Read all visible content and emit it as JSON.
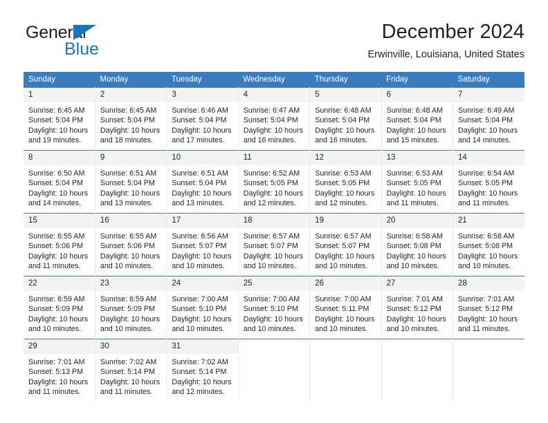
{
  "brand": {
    "name_part1": "General",
    "name_part2": "Blue",
    "triangle_icon": "triangle-icon",
    "accent_color": "#1b75bb"
  },
  "header": {
    "title": "December 2024",
    "subtitle": "Erwinville, Louisiana, United States"
  },
  "calendar": {
    "header_bg": "#3a7cc0",
    "daynum_bg": "#f3f3f3",
    "weekdays": [
      "Sunday",
      "Monday",
      "Tuesday",
      "Wednesday",
      "Thursday",
      "Friday",
      "Saturday"
    ],
    "weeks": [
      [
        {
          "day": "1",
          "sunrise": "Sunrise: 6:45 AM",
          "sunset": "Sunset: 5:04 PM",
          "daylight1": "Daylight: 10 hours",
          "daylight2": "and 19 minutes."
        },
        {
          "day": "2",
          "sunrise": "Sunrise: 6:45 AM",
          "sunset": "Sunset: 5:04 PM",
          "daylight1": "Daylight: 10 hours",
          "daylight2": "and 18 minutes."
        },
        {
          "day": "3",
          "sunrise": "Sunrise: 6:46 AM",
          "sunset": "Sunset: 5:04 PM",
          "daylight1": "Daylight: 10 hours",
          "daylight2": "and 17 minutes."
        },
        {
          "day": "4",
          "sunrise": "Sunrise: 6:47 AM",
          "sunset": "Sunset: 5:04 PM",
          "daylight1": "Daylight: 10 hours",
          "daylight2": "and 16 minutes."
        },
        {
          "day": "5",
          "sunrise": "Sunrise: 6:48 AM",
          "sunset": "Sunset: 5:04 PM",
          "daylight1": "Daylight: 10 hours",
          "daylight2": "and 16 minutes."
        },
        {
          "day": "6",
          "sunrise": "Sunrise: 6:48 AM",
          "sunset": "Sunset: 5:04 PM",
          "daylight1": "Daylight: 10 hours",
          "daylight2": "and 15 minutes."
        },
        {
          "day": "7",
          "sunrise": "Sunrise: 6:49 AM",
          "sunset": "Sunset: 5:04 PM",
          "daylight1": "Daylight: 10 hours",
          "daylight2": "and 14 minutes."
        }
      ],
      [
        {
          "day": "8",
          "sunrise": "Sunrise: 6:50 AM",
          "sunset": "Sunset: 5:04 PM",
          "daylight1": "Daylight: 10 hours",
          "daylight2": "and 14 minutes."
        },
        {
          "day": "9",
          "sunrise": "Sunrise: 6:51 AM",
          "sunset": "Sunset: 5:04 PM",
          "daylight1": "Daylight: 10 hours",
          "daylight2": "and 13 minutes."
        },
        {
          "day": "10",
          "sunrise": "Sunrise: 6:51 AM",
          "sunset": "Sunset: 5:04 PM",
          "daylight1": "Daylight: 10 hours",
          "daylight2": "and 13 minutes."
        },
        {
          "day": "11",
          "sunrise": "Sunrise: 6:52 AM",
          "sunset": "Sunset: 5:05 PM",
          "daylight1": "Daylight: 10 hours",
          "daylight2": "and 12 minutes."
        },
        {
          "day": "12",
          "sunrise": "Sunrise: 6:53 AM",
          "sunset": "Sunset: 5:05 PM",
          "daylight1": "Daylight: 10 hours",
          "daylight2": "and 12 minutes."
        },
        {
          "day": "13",
          "sunrise": "Sunrise: 6:53 AM",
          "sunset": "Sunset: 5:05 PM",
          "daylight1": "Daylight: 10 hours",
          "daylight2": "and 11 minutes."
        },
        {
          "day": "14",
          "sunrise": "Sunrise: 6:54 AM",
          "sunset": "Sunset: 5:05 PM",
          "daylight1": "Daylight: 10 hours",
          "daylight2": "and 11 minutes."
        }
      ],
      [
        {
          "day": "15",
          "sunrise": "Sunrise: 6:55 AM",
          "sunset": "Sunset: 5:06 PM",
          "daylight1": "Daylight: 10 hours",
          "daylight2": "and 11 minutes."
        },
        {
          "day": "16",
          "sunrise": "Sunrise: 6:55 AM",
          "sunset": "Sunset: 5:06 PM",
          "daylight1": "Daylight: 10 hours",
          "daylight2": "and 10 minutes."
        },
        {
          "day": "17",
          "sunrise": "Sunrise: 6:56 AM",
          "sunset": "Sunset: 5:07 PM",
          "daylight1": "Daylight: 10 hours",
          "daylight2": "and 10 minutes."
        },
        {
          "day": "18",
          "sunrise": "Sunrise: 6:57 AM",
          "sunset": "Sunset: 5:07 PM",
          "daylight1": "Daylight: 10 hours",
          "daylight2": "and 10 minutes."
        },
        {
          "day": "19",
          "sunrise": "Sunrise: 6:57 AM",
          "sunset": "Sunset: 5:07 PM",
          "daylight1": "Daylight: 10 hours",
          "daylight2": "and 10 minutes."
        },
        {
          "day": "20",
          "sunrise": "Sunrise: 6:58 AM",
          "sunset": "Sunset: 5:08 PM",
          "daylight1": "Daylight: 10 hours",
          "daylight2": "and 10 minutes."
        },
        {
          "day": "21",
          "sunrise": "Sunrise: 6:58 AM",
          "sunset": "Sunset: 5:08 PM",
          "daylight1": "Daylight: 10 hours",
          "daylight2": "and 10 minutes."
        }
      ],
      [
        {
          "day": "22",
          "sunrise": "Sunrise: 6:59 AM",
          "sunset": "Sunset: 5:09 PM",
          "daylight1": "Daylight: 10 hours",
          "daylight2": "and 10 minutes."
        },
        {
          "day": "23",
          "sunrise": "Sunrise: 6:59 AM",
          "sunset": "Sunset: 5:09 PM",
          "daylight1": "Daylight: 10 hours",
          "daylight2": "and 10 minutes."
        },
        {
          "day": "24",
          "sunrise": "Sunrise: 7:00 AM",
          "sunset": "Sunset: 5:10 PM",
          "daylight1": "Daylight: 10 hours",
          "daylight2": "and 10 minutes."
        },
        {
          "day": "25",
          "sunrise": "Sunrise: 7:00 AM",
          "sunset": "Sunset: 5:10 PM",
          "daylight1": "Daylight: 10 hours",
          "daylight2": "and 10 minutes."
        },
        {
          "day": "26",
          "sunrise": "Sunrise: 7:00 AM",
          "sunset": "Sunset: 5:11 PM",
          "daylight1": "Daylight: 10 hours",
          "daylight2": "and 10 minutes."
        },
        {
          "day": "27",
          "sunrise": "Sunrise: 7:01 AM",
          "sunset": "Sunset: 5:12 PM",
          "daylight1": "Daylight: 10 hours",
          "daylight2": "and 10 minutes."
        },
        {
          "day": "28",
          "sunrise": "Sunrise: 7:01 AM",
          "sunset": "Sunset: 5:12 PM",
          "daylight1": "Daylight: 10 hours",
          "daylight2": "and 11 minutes."
        }
      ],
      [
        {
          "day": "29",
          "sunrise": "Sunrise: 7:01 AM",
          "sunset": "Sunset: 5:13 PM",
          "daylight1": "Daylight: 10 hours",
          "daylight2": "and 11 minutes."
        },
        {
          "day": "30",
          "sunrise": "Sunrise: 7:02 AM",
          "sunset": "Sunset: 5:14 PM",
          "daylight1": "Daylight: 10 hours",
          "daylight2": "and 11 minutes."
        },
        {
          "day": "31",
          "sunrise": "Sunrise: 7:02 AM",
          "sunset": "Sunset: 5:14 PM",
          "daylight1": "Daylight: 10 hours",
          "daylight2": "and 12 minutes."
        },
        {
          "day": "",
          "sunrise": "",
          "sunset": "",
          "daylight1": "",
          "daylight2": ""
        },
        {
          "day": "",
          "sunrise": "",
          "sunset": "",
          "daylight1": "",
          "daylight2": ""
        },
        {
          "day": "",
          "sunrise": "",
          "sunset": "",
          "daylight1": "",
          "daylight2": ""
        },
        {
          "day": "",
          "sunrise": "",
          "sunset": "",
          "daylight1": "",
          "daylight2": ""
        }
      ]
    ]
  }
}
